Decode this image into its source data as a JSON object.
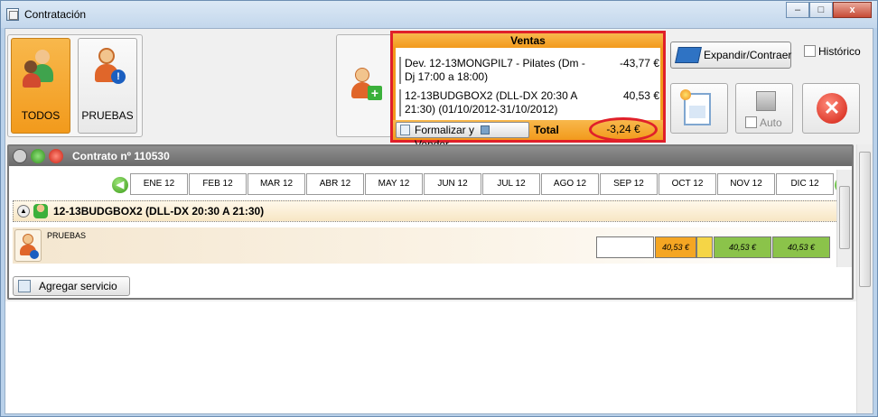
{
  "window": {
    "title": "Contratación",
    "buttons": {
      "minimize": "–",
      "maximize": "□",
      "close": "x"
    }
  },
  "toolbar": {
    "tiles": [
      {
        "label": "TODOS"
      },
      {
        "label": "PRUEBAS"
      }
    ],
    "expand_label": "Expandir/Contraer",
    "historico_label": "Histórico",
    "auto_label": "Auto"
  },
  "ventas": {
    "header": "Ventas",
    "items": [
      {
        "desc": "Dev. 12-13MONGPIL7 - Pilates (Dm - Dj 17:00 a 18:00)",
        "amount": "-43,77 €"
      },
      {
        "desc": "12-13BUDGBOX2 (DLL-DX 20:30 A 21:30) (01/10/2012-31/10/2012)",
        "amount": "40,53 €"
      }
    ],
    "formalizar_label": "Formalizar y",
    "vender_label": "Vender",
    "total_label": "Total",
    "total_value": "-3,24 €"
  },
  "contract": {
    "title": "Contrato nº 110530",
    "months": [
      "ENE 12",
      "FEB 12",
      "MAR 12",
      "ABR 12",
      "MAY 12",
      "JUN 12",
      "JUL 12",
      "AGO 12",
      "SEP 12",
      "OCT 12",
      "NOV 12",
      "DIC 12"
    ],
    "service_title": "12-13BUDGBOX2 (DLL-DX 20:30 A 21:30)",
    "row_label": "PRUEBAS",
    "cells": {
      "oct": "40,53 €",
      "nov": "40,53 €",
      "dic": "40,53 €"
    },
    "add_service_label": "Agregar servicio ..."
  },
  "colors": {
    "accent_orange": "#f29a1c",
    "highlight_red": "#e0202a",
    "paid_green": "#8bc34a"
  }
}
